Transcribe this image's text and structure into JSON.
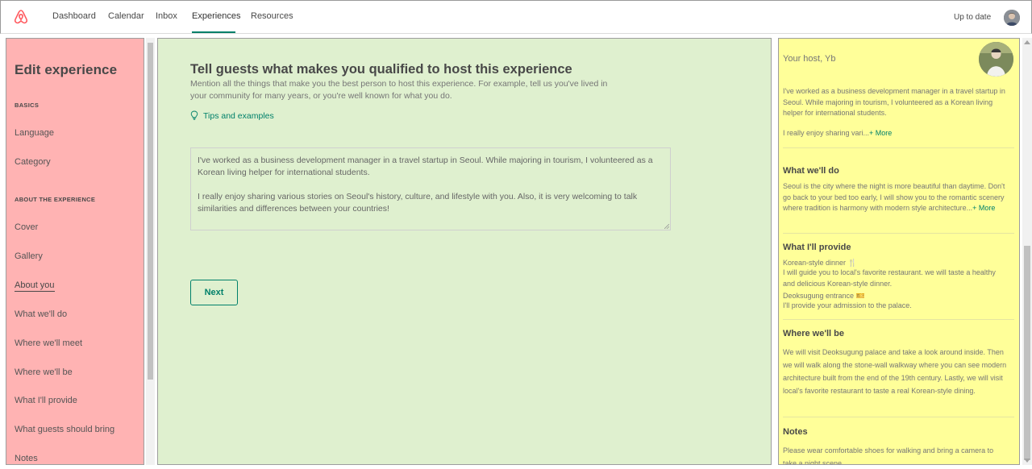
{
  "colors": {
    "accent": "#00806a",
    "sidebar_bg": "#ffb3b3",
    "main_bg": "#dff0cf",
    "preview_bg": "#ffff99"
  },
  "nav": {
    "logo_icon": "airbnb-logo-icon",
    "items": [
      "Dashboard",
      "Calendar",
      "Inbox",
      "Experiences",
      "Resources"
    ],
    "active": "Experiences",
    "status": "Up to date"
  },
  "sidebar": {
    "title": "Edit experience",
    "sections": [
      "BASICS",
      "ABOUT THE EXPERIENCE"
    ],
    "items": [
      "Language",
      "Category",
      "Cover",
      "Gallery",
      "About you",
      "What we'll do",
      "Where we'll meet",
      "Where we'll be",
      "What I'll provide",
      "What guests should bring",
      "Notes"
    ],
    "active_item": "About you"
  },
  "main": {
    "heading": "Tell guests what makes you qualified to host this experience",
    "subtext": "Mention all the things that make you the best person to host this experience. For example, tell us you've lived in your community for many years, or you're well known for what you do.",
    "tips_label": "Tips and examples",
    "tips_icon": "lightbulb-icon",
    "textarea_p1": "I've worked as a business development manager in a travel startup in Seoul. While majoring in tourism, I volunteered as a Korean living helper for international students.",
    "textarea_p2": "I really enjoy sharing various stories on Seoul's history, culture, and lifestyle with you. Also, it is very welcoming to talk similarities and differences between your countries!",
    "next_label": "Next"
  },
  "preview": {
    "host_label": "Your host, Yb",
    "host_p1": "I've worked as a business development manager in a travel startup in Seoul. While majoring in tourism, I volunteered as a Korean living helper for international students.",
    "host_p2": "I really enjoy sharing vari...",
    "more_label": "+ More",
    "do_heading": "What we'll do",
    "do_text": "Seoul is the city where the night is more beautiful than daytime. Don't go back to your bed too early, I will show you to the romantic scenery where tradition is harmony with modern style architecture...",
    "provide_heading": "What I'll provide",
    "provide_item1_title": "Korean-style dinner 🍴",
    "provide_item1_desc": "I will guide you to local's favorite restaurant. we will taste a healthy and delicious Korean-style dinner.",
    "provide_item2_title": "Deoksugung entrance 🎫",
    "provide_item2_desc": "I'll provide your admission to the palace.",
    "be_heading": "Where we'll be",
    "be_text": "We will visit Deoksugung palace and take a look around inside. Then we will walk along the stone-wall walkway where you can see modern architecture built from the end of the 19th century. Lastly, we will visit local's favorite restaurant to taste a real Korean-style dining.",
    "notes_heading": "Notes",
    "notes_text": "Please wear comfortable shoes for walking and bring a camera to take a night scene."
  }
}
